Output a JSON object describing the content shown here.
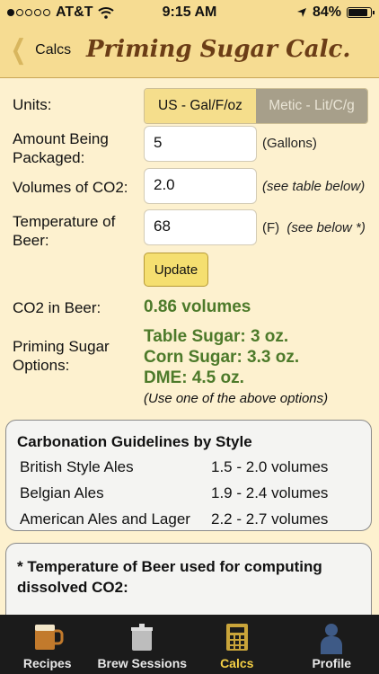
{
  "status": {
    "carrier": "AT&T",
    "time": "9:15 AM",
    "battery": "84%"
  },
  "nav": {
    "back_label": "Calcs",
    "title": "Priming Sugar Calc."
  },
  "form": {
    "units_label": "Units:",
    "unit_us": "US - Gal/F/oz",
    "unit_metric": "Metic - Lit/C/g",
    "amount_label_1": "Amount Being",
    "amount_label_2": "Packaged:",
    "amount_value": "5",
    "amount_unit": "(Gallons)",
    "co2_label": "Volumes of CO2:",
    "co2_value": "2.0",
    "co2_hint": "(see table below)",
    "temp_label_1": "Temperature of",
    "temp_label_2": "Beer:",
    "temp_value": "68",
    "temp_unit": "(F)",
    "temp_hint": "(see below *)",
    "update_label": "Update"
  },
  "results": {
    "co2_label": "CO2 in Beer:",
    "co2_value": "0.86 volumes",
    "sugar_label_1": "Priming Sugar",
    "sugar_label_2": "Options:",
    "table_sugar": "Table Sugar: 3 oz.",
    "corn_sugar": "Corn Sugar: 3.3 oz.",
    "dme": "DME: 4.5 oz.",
    "note": "(Use one of the above options)"
  },
  "guidelines": {
    "title": "Carbonation Guidelines by Style",
    "rows": [
      {
        "style": "British Style Ales",
        "range": "1.5 - 2.0 volumes"
      },
      {
        "style": "Belgian Ales",
        "range": "1.9 - 2.4 volumes"
      },
      {
        "style": "American Ales and Lager",
        "range": "2.2 - 2.7 volumes"
      }
    ]
  },
  "temp_note": {
    "line1": "* Temperature of Beer used for computing",
    "line2": "dissolved CO2:"
  },
  "tabs": [
    {
      "label": "Recipes",
      "icon": "beer-mug-icon"
    },
    {
      "label": "Brew Sessions",
      "icon": "brew-kettle-icon"
    },
    {
      "label": "Calcs",
      "icon": "calculator-icon"
    },
    {
      "label": "Profile",
      "icon": "person-icon"
    }
  ],
  "colors": {
    "accent": "#f4cf45",
    "result_green": "#4d7a2a",
    "title_brown": "#6b3d16"
  }
}
